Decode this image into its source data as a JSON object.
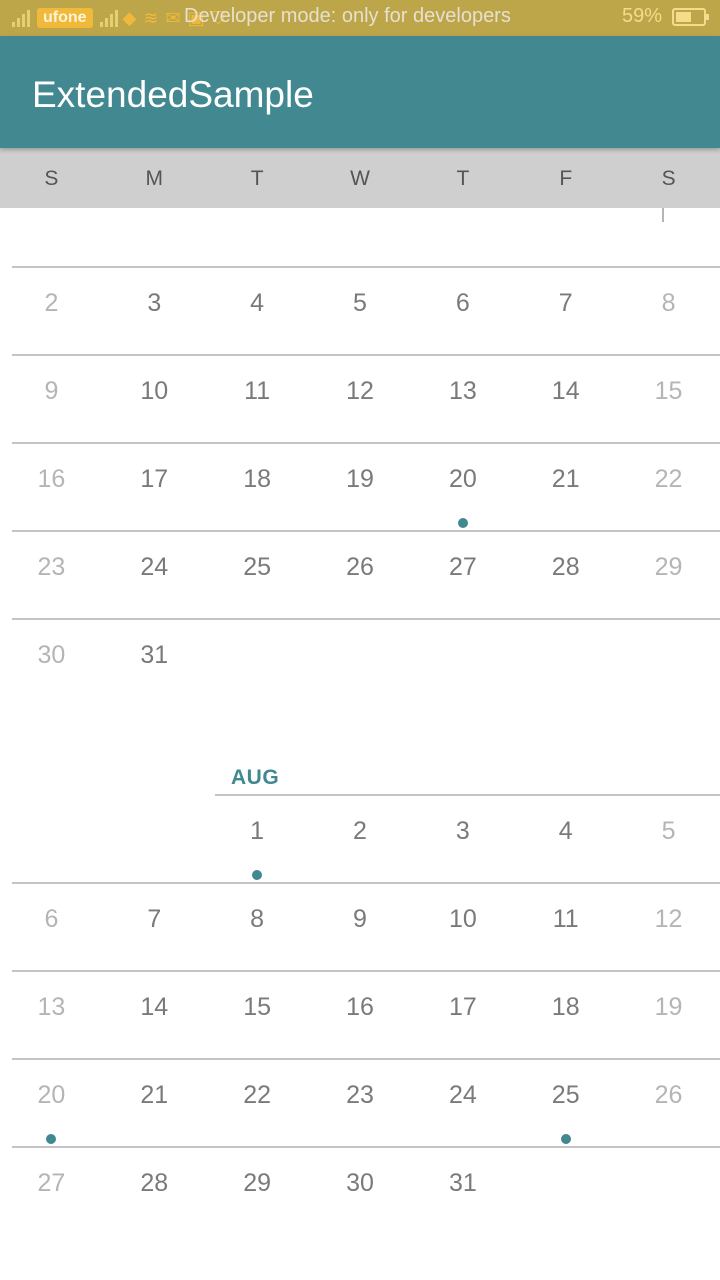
{
  "status_bar": {
    "carrier": "ufone",
    "notification_text": "Developer mode: only for developers",
    "battery": "59%",
    "battery_level": 0.59
  },
  "app_bar": {
    "title": "ExtendedSample"
  },
  "weekdays": [
    "S",
    "M",
    "T",
    "W",
    "T",
    "F",
    "S"
  ],
  "calendar": {
    "july_rows": [
      [
        "2",
        "3",
        "4",
        "5",
        "6",
        "7",
        "8"
      ],
      [
        "9",
        "10",
        "11",
        "12",
        "13",
        "14",
        "15"
      ],
      [
        "16",
        "17",
        "18",
        "19",
        "20",
        "21",
        "22"
      ],
      [
        "23",
        "24",
        "25",
        "26",
        "27",
        "28",
        "29"
      ],
      [
        "30",
        "31",
        "",
        "",
        "",
        "",
        ""
      ]
    ],
    "july_event_days": [
      "20"
    ],
    "august_label": "AUG",
    "august_rows": [
      [
        "",
        "",
        "1",
        "2",
        "3",
        "4",
        "5"
      ],
      [
        "6",
        "7",
        "8",
        "9",
        "10",
        "11",
        "12"
      ],
      [
        "13",
        "14",
        "15",
        "16",
        "17",
        "18",
        "19"
      ],
      [
        "20",
        "21",
        "22",
        "23",
        "24",
        "25",
        "26"
      ],
      [
        "27",
        "28",
        "29",
        "30",
        "31",
        "",
        ""
      ]
    ],
    "august_event_days": [
      "1",
      "20",
      "25"
    ]
  },
  "colors": {
    "status_bar": "#bda54a",
    "app_bar": "#418891",
    "weekday_header": "#cfcfcf",
    "event_dot": "#418891",
    "weekday_text": "#7a7a7a",
    "weekend_text": "#b5b5b5"
  }
}
